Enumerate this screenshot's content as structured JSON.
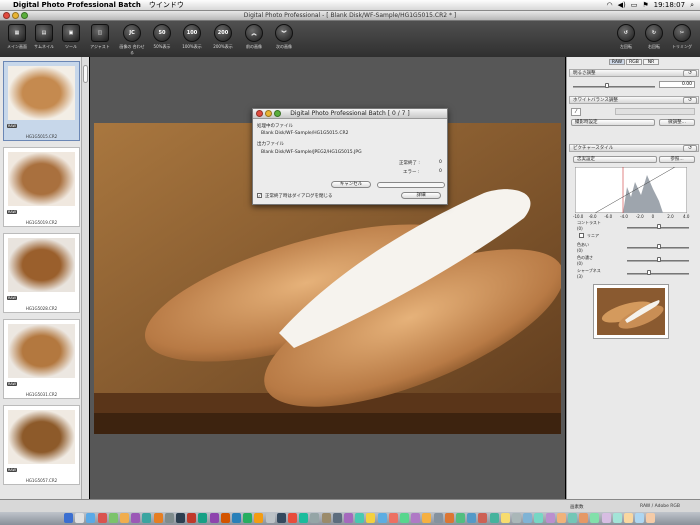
{
  "menubar": {
    "app_name": "Digital Photo Professional Batch",
    "menu_window": "ウインドウ",
    "clock": "19:18:07"
  },
  "window": {
    "title": "Digital Photo Professional - [ Blank Disk/WF-Sample/HG1G5015.CR2 * ]"
  },
  "toolbar": {
    "buttons": [
      {
        "label": "メイン画面",
        "glyph": "▦"
      },
      {
        "label": "サムネイル",
        "glyph": "▤"
      },
      {
        "label": "ツール",
        "glyph": "▣"
      },
      {
        "label": "アジャスト",
        "glyph": "◫"
      },
      {
        "label": "画像の\n合わせる",
        "glyph": "JC"
      },
      {
        "label": "50%表示",
        "glyph": "50"
      },
      {
        "label": "100%表示",
        "glyph": "100"
      },
      {
        "label": "200%表示",
        "glyph": "200"
      },
      {
        "label": "前の画像",
        "glyph": "︽"
      },
      {
        "label": "次の画像",
        "glyph": "︾"
      }
    ],
    "right_buttons": [
      {
        "label": "左回転",
        "glyph": "↺"
      },
      {
        "label": "右回転",
        "glyph": "↻"
      },
      {
        "label": "トリミング",
        "glyph": "✂"
      }
    ]
  },
  "filmstrip": {
    "items": [
      {
        "caption": "HG1G5015.CR2",
        "badge": "RAW",
        "selected": true
      },
      {
        "caption": "HG1G5019.CR2",
        "badge": "RAW",
        "selected": false
      },
      {
        "caption": "HG1G5028.CR2",
        "badge": "RAW",
        "selected": false
      },
      {
        "caption": "HG1G5031.CR2",
        "badge": "RAW",
        "selected": false
      },
      {
        "caption": "HG1G5057.CR2",
        "badge": "RAW",
        "selected": false
      }
    ]
  },
  "dialog": {
    "title": "Digital Photo Professional Batch [ 0 / 7 ]",
    "processing_label": "処理中のファイル",
    "processing_value": "Blank Disk/WF-Sample/HG1G5015.CR2",
    "output_label": "出力ファイル",
    "output_value": "Blank Disk/WF-Sample/JPEG2/HG1G5015.JPG",
    "done_label": "正常終了 :",
    "done_value": "0",
    "error_label": "エラー :",
    "error_value": "0",
    "cancel_label": "キャンセル",
    "progress": 0,
    "close_checkbox_label": "正常終了時はダイアログを閉じる",
    "close_checked": true,
    "detail_label": "詳細"
  },
  "rightpanel": {
    "tabs": [
      "RAW",
      "RGB",
      "NR"
    ],
    "brightness_label": "明るさ調整",
    "brightness_value": "0.00",
    "wb_label": "ホワイトバランス調整",
    "wb_preset": "撮影時設定",
    "wb_fine_button": "微調整...",
    "picture_style_label": "ピクチャースタイル",
    "picture_style_value": "忠実設定",
    "browse_button": "参照...",
    "hist_ticks": [
      "-10.0",
      "-8.0",
      "-6.0",
      "-4.0",
      "-2.0",
      "0",
      "2.0",
      "4.0"
    ],
    "contrast_label": "コントラスト",
    "contrast_value": "(0)",
    "linear_label": "リニア",
    "hue_label": "色あい",
    "hue_value": "(0)",
    "saturation_label": "色の濃さ",
    "saturation_value": "(0)",
    "sharpness_label": "シャープネス",
    "sharpness_value": "(3)"
  },
  "statusbar": {
    "left_text": "画素数",
    "right_text": "RAW / Adobe RGB"
  },
  "colors": {
    "toolbar_bg": "#3e3e3e",
    "selection": "#c7d7ea",
    "canvas_bg": "#575757"
  }
}
